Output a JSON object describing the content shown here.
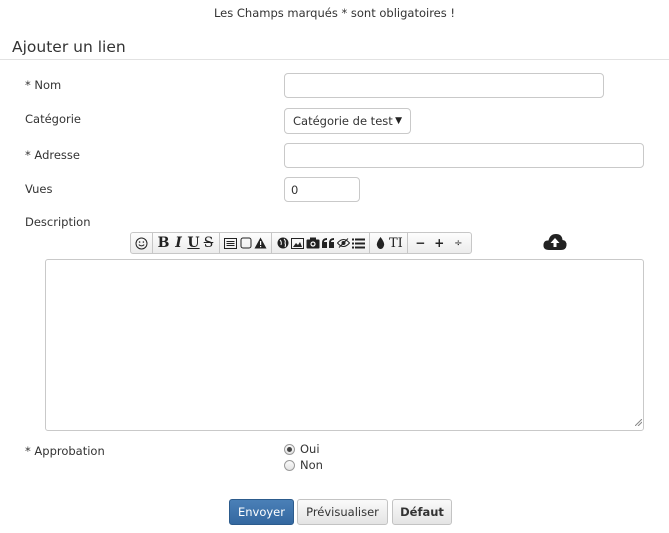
{
  "notice": "Les Champs marqués * sont obligatoires !",
  "form": {
    "legend": "Ajouter un lien",
    "name": {
      "label": "* Nom",
      "value": ""
    },
    "category": {
      "label": "Catégorie",
      "selected": "Catégorie de test"
    },
    "address": {
      "label": "* Adresse",
      "value": ""
    },
    "views": {
      "label": "Vues",
      "value": "0"
    },
    "description": {
      "label": "Description",
      "value": ""
    },
    "approval": {
      "label": "* Approbation",
      "options": [
        {
          "label": "Oui",
          "checked": true
        },
        {
          "label": "Non",
          "checked": false
        }
      ]
    }
  },
  "toolbar": {
    "bold": "B",
    "italic": "I",
    "underline": "U",
    "strike": "S",
    "size": "TI",
    "minus": "−",
    "plus": "+",
    "updown": "÷",
    "icons": [
      "smiley-icon",
      "bold-icon",
      "italic-icon",
      "underline-icon",
      "strikethrough-icon",
      "code-icon",
      "box-icon",
      "warning-icon",
      "globe-icon",
      "image-icon",
      "camera-icon",
      "quote-icon",
      "hide-icon",
      "list-icon",
      "color-drop-icon",
      "font-size-icon",
      "minus-icon",
      "plus-icon",
      "resize-icon",
      "cloud-upload-icon"
    ]
  },
  "buttons": {
    "submit": "Envoyer",
    "preview": "Prévisualiser",
    "reset": "Défaut"
  }
}
